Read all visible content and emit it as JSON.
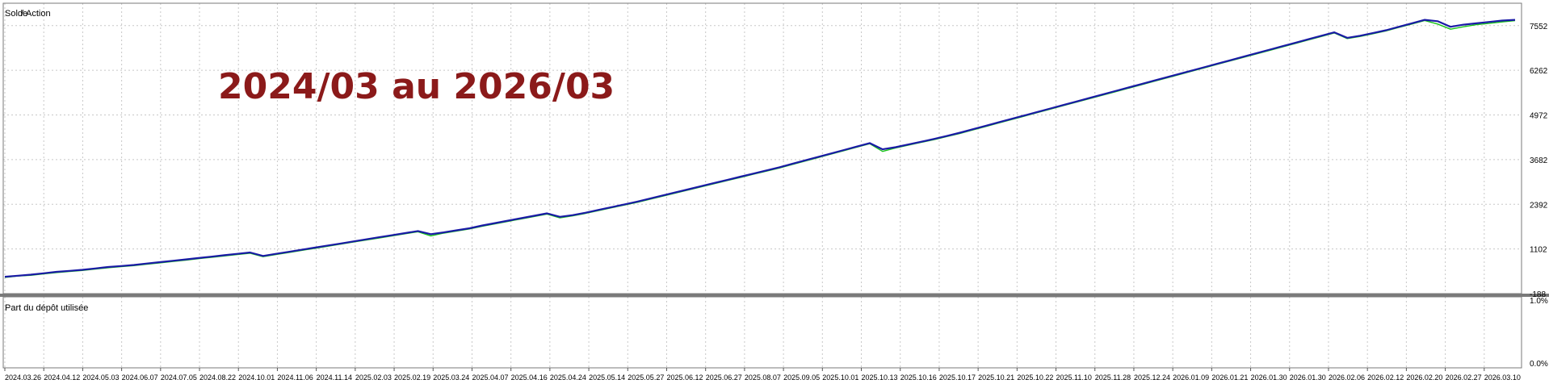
{
  "annotation": "2024/03 au 2026/03",
  "colors": {
    "balance": "#1a1aa6",
    "equity": "#18c418",
    "annotation": "#8b1a1a",
    "grid": "#c8c8c8",
    "frame": "#7a7a7a",
    "separator": "#7a7a7a"
  },
  "chart_data": [
    {
      "type": "line",
      "legend": [
        {
          "name": "Solde",
          "color": "#1a1aa6"
        },
        {
          "name": "Action",
          "color": "#18c418"
        }
      ],
      "legend_separator": "/",
      "y_ticks": [
        7552,
        6262,
        4972,
        3682,
        2392,
        1102,
        -188
      ],
      "y_tick_labels": [
        "7552",
        "6262",
        "4972",
        "3682",
        "2392",
        "1102",
        "-188"
      ],
      "ylim": [
        -188,
        8200
      ],
      "grid": true,
      "x_labels": [
        "2024.03.26",
        "2024.04.12",
        "2024.05.03",
        "2024.06.07",
        "2024.07.05",
        "2024.08.22",
        "2024.10.01",
        "2024.11.06",
        "2024.11.14",
        "2025.02.03",
        "2025.02.19",
        "2025.03.24",
        "2025.04.07",
        "2025.04.16",
        "2025.04.24",
        "2025.05.14",
        "2025.05.27",
        "2025.06.12",
        "2025.06.27",
        "2025.08.07",
        "2025.09.05",
        "2025.10.01",
        "2025.10.13",
        "2025.10.16",
        "2025.10.17",
        "2025.10.21",
        "2025.10.22",
        "2025.11.10",
        "2025.11.28",
        "2025.12.24",
        "2026.01.09",
        "2026.01.21",
        "2026.01.30",
        "2026.01.30",
        "2026.02.06",
        "2026.02.12",
        "2026.02.20",
        "2026.02.27",
        "2026.03.10"
      ],
      "series": [
        {
          "name": "Solde",
          "values": [
            300,
            330,
            360,
            400,
            440,
            470,
            500,
            540,
            580,
            610,
            640,
            680,
            720,
            760,
            800,
            840,
            880,
            920,
            960,
            1000,
            900,
            960,
            1020,
            1080,
            1140,
            1200,
            1260,
            1320,
            1380,
            1440,
            1500,
            1560,
            1620,
            1530,
            1580,
            1640,
            1700,
            1780,
            1850,
            1920,
            1990,
            2060,
            2130,
            2030,
            2080,
            2150,
            2230,
            2310,
            2390,
            2470,
            2560,
            2650,
            2740,
            2830,
            2920,
            3010,
            3100,
            3190,
            3280,
            3370,
            3460,
            3560,
            3660,
            3760,
            3860,
            3960,
            4060,
            4160,
            3980,
            4040,
            4120,
            4200,
            4280,
            4370,
            4460,
            4560,
            4660,
            4760,
            4860,
            4960,
            5060,
            5160,
            5260,
            5360,
            5460,
            5560,
            5660,
            5760,
            5860,
            5960,
            6060,
            6160,
            6260,
            6360,
            6460,
            6560,
            6660,
            6760,
            6860,
            6960,
            7060,
            7160,
            7260,
            7360,
            7200,
            7260,
            7340,
            7420,
            7520,
            7620,
            7720,
            7680,
            7520,
            7580,
            7620,
            7660,
            7700,
            7720
          ]
        },
        {
          "name": "Action",
          "values": [
            280,
            320,
            340,
            380,
            420,
            450,
            480,
            520,
            560,
            590,
            620,
            660,
            700,
            740,
            780,
            820,
            860,
            900,
            940,
            980,
            880,
            940,
            1000,
            1060,
            1120,
            1180,
            1240,
            1300,
            1360,
            1420,
            1480,
            1540,
            1600,
            1480,
            1560,
            1620,
            1680,
            1760,
            1830,
            1900,
            1970,
            2040,
            2110,
            2000,
            2060,
            2130,
            2210,
            2290,
            2370,
            2450,
            2540,
            2630,
            2720,
            2810,
            2900,
            2990,
            3080,
            3170,
            3260,
            3350,
            3440,
            3540,
            3640,
            3740,
            3840,
            3940,
            4040,
            4140,
            3920,
            4020,
            4100,
            4180,
            4260,
            4350,
            4440,
            4540,
            4640,
            4740,
            4840,
            4940,
            5040,
            5140,
            5240,
            5340,
            5440,
            5540,
            5640,
            5740,
            5840,
            5940,
            6040,
            6140,
            6240,
            6340,
            6440,
            6540,
            6640,
            6740,
            6840,
            6940,
            7040,
            7140,
            7240,
            7340,
            7180,
            7240,
            7320,
            7400,
            7500,
            7600,
            7700,
            7600,
            7450,
            7520,
            7580,
            7620,
            7660,
            7700
          ]
        }
      ]
    },
    {
      "type": "area",
      "title": "Part du dépôt utilisée",
      "y_tick_labels": [
        "1.0%",
        "0.0%"
      ],
      "ylim": [
        0,
        1
      ],
      "grid": true,
      "series": []
    }
  ]
}
